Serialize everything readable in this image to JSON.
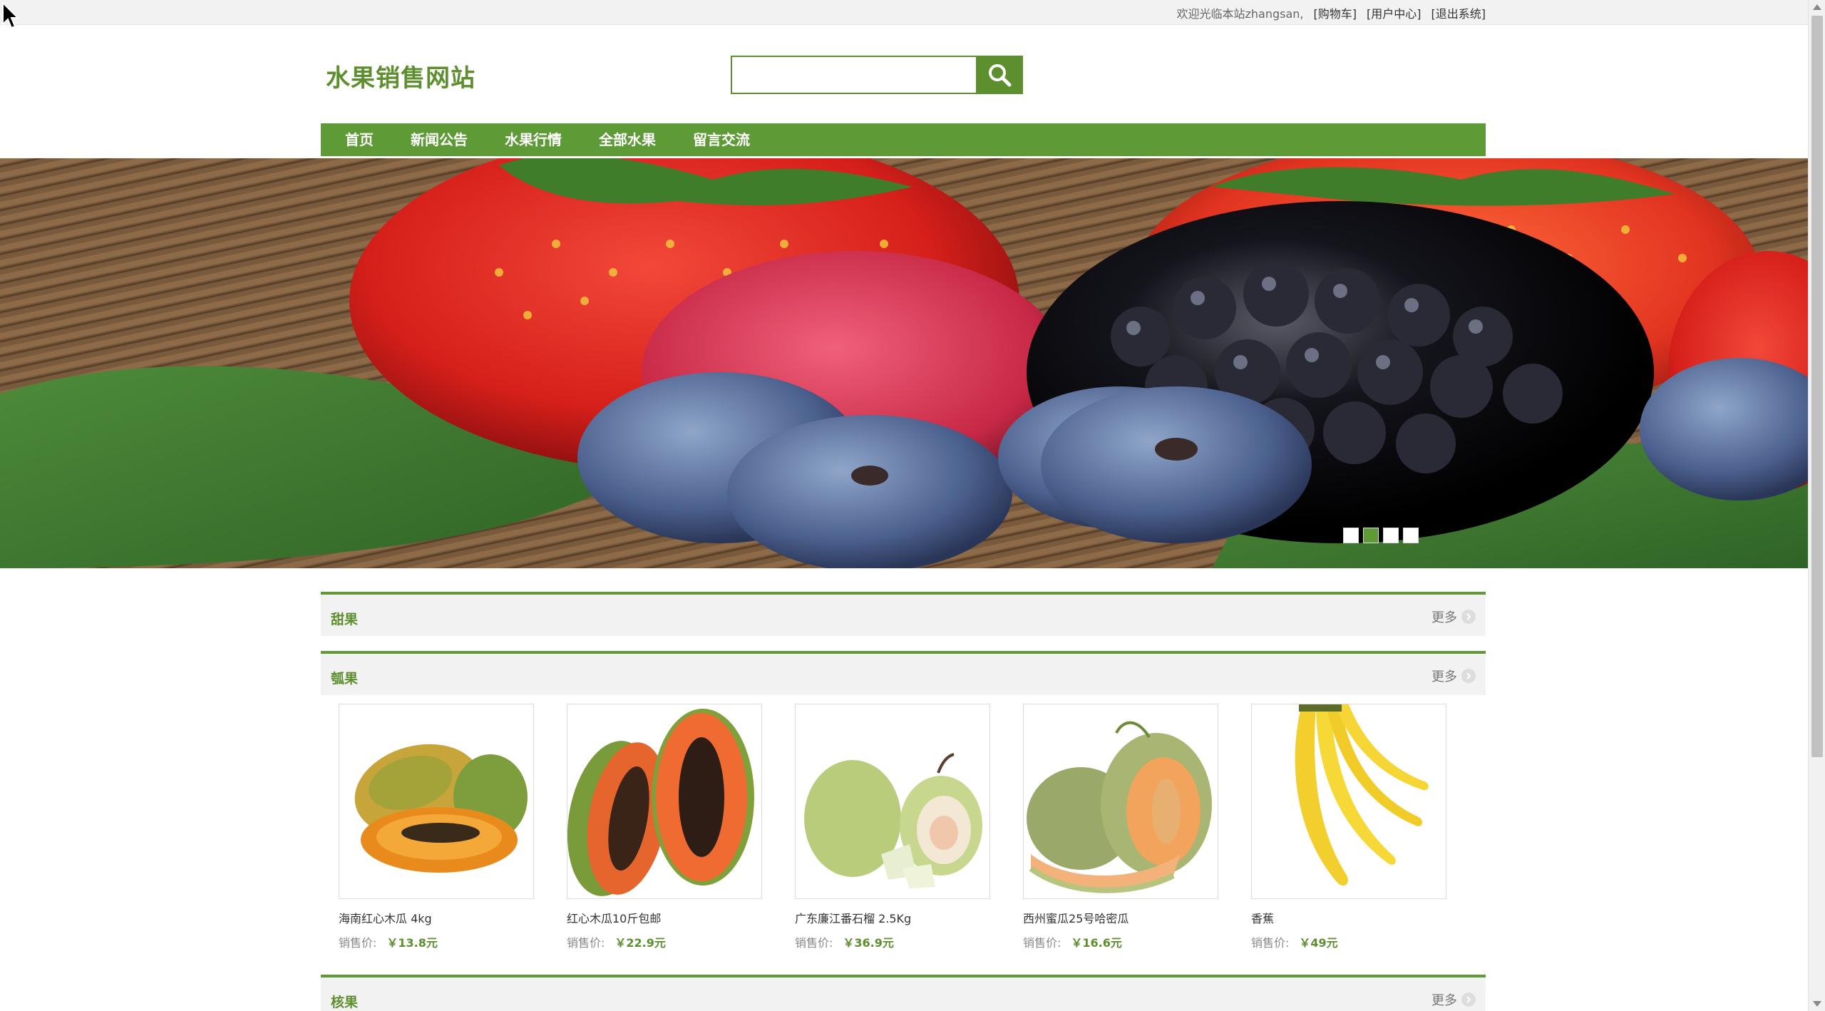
{
  "topbar": {
    "welcome": "欢迎光临本站zhangsan,",
    "cart": "[购物车]",
    "user_center": "[用户中心]",
    "logout": "[退出系统]"
  },
  "header": {
    "logo": "水果销售网站",
    "search_placeholder": ""
  },
  "nav": {
    "items": [
      "首页",
      "新闻公告",
      "水果行情",
      "全部水果",
      "留言交流"
    ]
  },
  "banner": {
    "slide_count": 4,
    "active_slide": 2
  },
  "sections": [
    {
      "title": "甜果",
      "more": "更多"
    },
    {
      "title": "瓠果",
      "more": "更多"
    },
    {
      "title": "核果",
      "more": "更多"
    }
  ],
  "products": [
    {
      "name": "海南红心木瓜 4kg",
      "price_label": "销售价:",
      "price": "￥13.8元"
    },
    {
      "name": "红心木瓜10斤包邮",
      "price_label": "销售价:",
      "price": "￥22.9元"
    },
    {
      "name": "广东廉江番石榴 2.5Kg",
      "price_label": "销售价:",
      "price": "￥36.9元"
    },
    {
      "name": "西州蜜瓜25号哈密瓜",
      "price_label": "销售价:",
      "price": "￥16.6元"
    },
    {
      "name": "香蕉",
      "price_label": "销售价:",
      "price": "￥49元"
    }
  ],
  "colors": {
    "brand_green": "#5e9a35",
    "text_green": "#5e8f2f"
  }
}
